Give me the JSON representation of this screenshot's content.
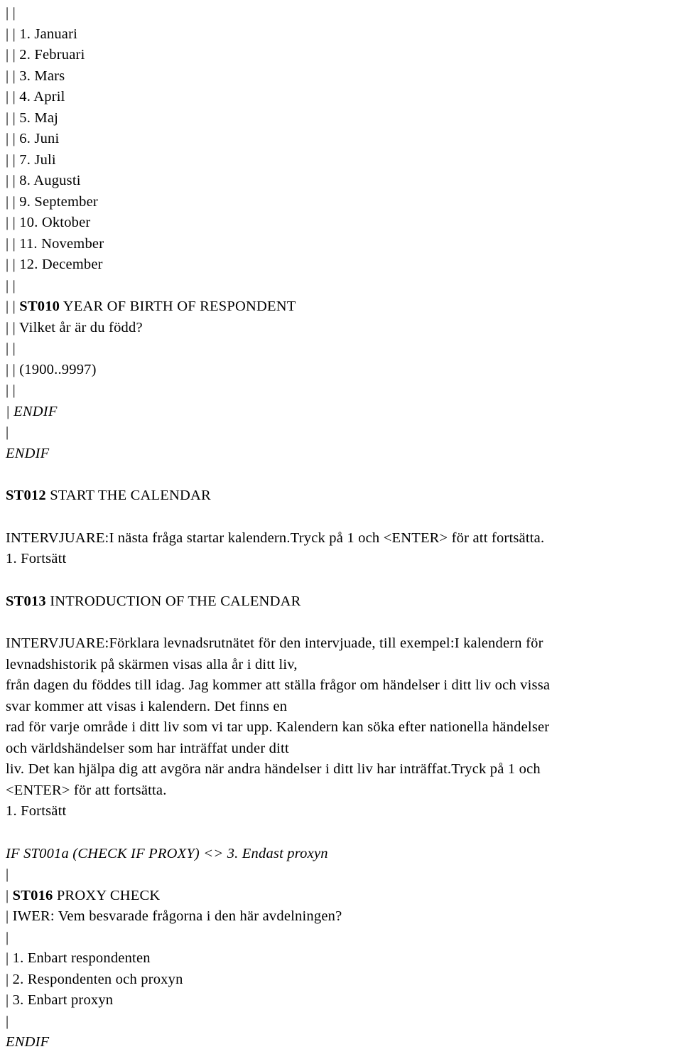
{
  "document": {
    "type": "questionnaire-specification",
    "language": "sv",
    "background_color": "#ffffff",
    "text_color": "#000000"
  },
  "month_list": {
    "prefix": "| | ",
    "blank_prefix": "| |",
    "items": [
      "| | 1. Januari",
      "| | 2. Februari",
      "| | 3. Mars",
      "| | 4. April",
      "| | 5. Maj",
      "| | 6. Juni",
      "| | 7. Juli",
      "| | 8. Augusti",
      "| | 9. September",
      "| | 10. Oktober",
      "| | 11. November",
      "| | 12. December"
    ]
  },
  "st010": {
    "blank_before": "| |",
    "pipes": "| | ",
    "code": "ST010",
    "title": " YEAR OF BIRTH OF RESPONDENT",
    "question_line": "| | Vilket år är du född?",
    "blank_mid": "| |",
    "range_line": "| | (1900..9997)",
    "blank_after": "| |"
  },
  "endif_block_1": {
    "inner": "| ENDIF",
    "pipe_only": "|",
    "outer": "ENDIF"
  },
  "st012": {
    "code": "ST012",
    "title": " START THE CALENDAR",
    "body_lines": [
      "INTERVJUARE:I nästa fråga startar kalendern.Tryck på 1 och <ENTER> för att fortsätta.",
      "1. Fortsätt"
    ]
  },
  "st013": {
    "code": "ST013",
    "title": " INTRODUCTION OF THE CALENDAR",
    "body_lines": [
      "INTERVJUARE:Förklara levnadsrutnätet för den intervjuade, till exempel:I kalendern för",
      "levnadshistorik på skärmen visas alla år i ditt liv,",
      "från dagen du föddes till idag. Jag kommer att ställa frågor om händelser i ditt liv och vissa",
      "svar kommer att visas i kalendern. Det finns en",
      "rad för varje område i ditt liv som vi tar upp. Kalendern kan söka efter nationella händelser",
      "och världshändelser som har inträffat under ditt",
      "liv. Det kan hjälpa dig att avgöra när andra händelser i ditt liv har inträffat.Tryck på 1 och",
      "<ENTER> för att fortsätta.",
      "1. Fortsätt"
    ]
  },
  "proxy_condition": {
    "line": "IF ST001a (CHECK IF PROXY) <> 3. Endast proxyn",
    "pipe_after": "|"
  },
  "st016": {
    "pipe": "| ",
    "code": "ST016",
    "title": " PROXY CHECK",
    "question_line": "| IWER: Vem besvarade frågorna i den här avdelningen?",
    "blank_line": "|",
    "options": [
      "| 1. Enbart respondenten",
      "| 2. Respondenten och proxyn",
      "| 3. Enbart proxyn"
    ],
    "pipe_after": "|"
  },
  "endif_block_2": {
    "outer": "ENDIF"
  }
}
